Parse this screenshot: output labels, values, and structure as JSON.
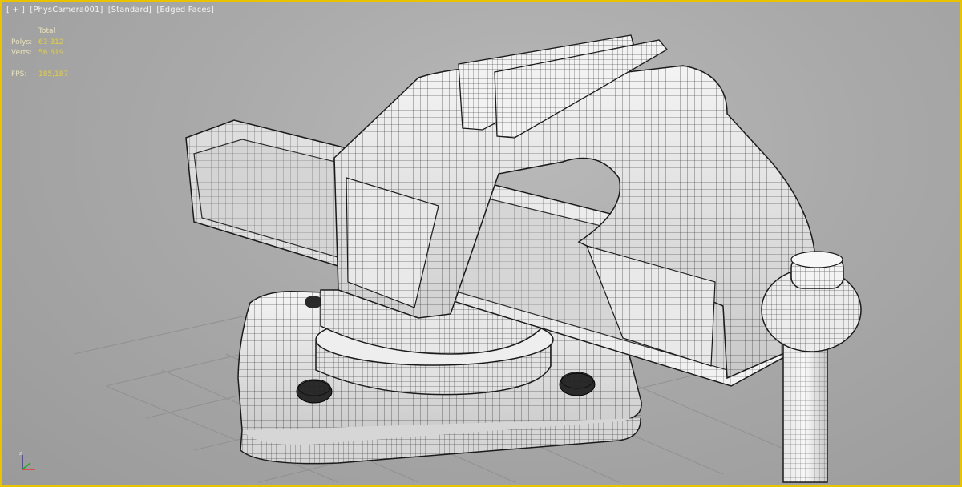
{
  "viewport": {
    "labels": [
      "[ + ]",
      "[PhysCamera001]",
      "[Standard]",
      "[Edged Faces]"
    ]
  },
  "stats": {
    "header": "Total",
    "rows": [
      {
        "label": "Polys:",
        "value": "63 312"
      },
      {
        "label": "Verts:",
        "value": "56 619"
      }
    ],
    "fps_label": "FPS:",
    "fps_value": "185,187"
  },
  "colors": {
    "viewport_border": "#e8c400",
    "stats_text": "#e7d03a",
    "background": "#a9a9a9"
  },
  "icons": {
    "axis_gizmo": "axis-tripod-icon"
  }
}
